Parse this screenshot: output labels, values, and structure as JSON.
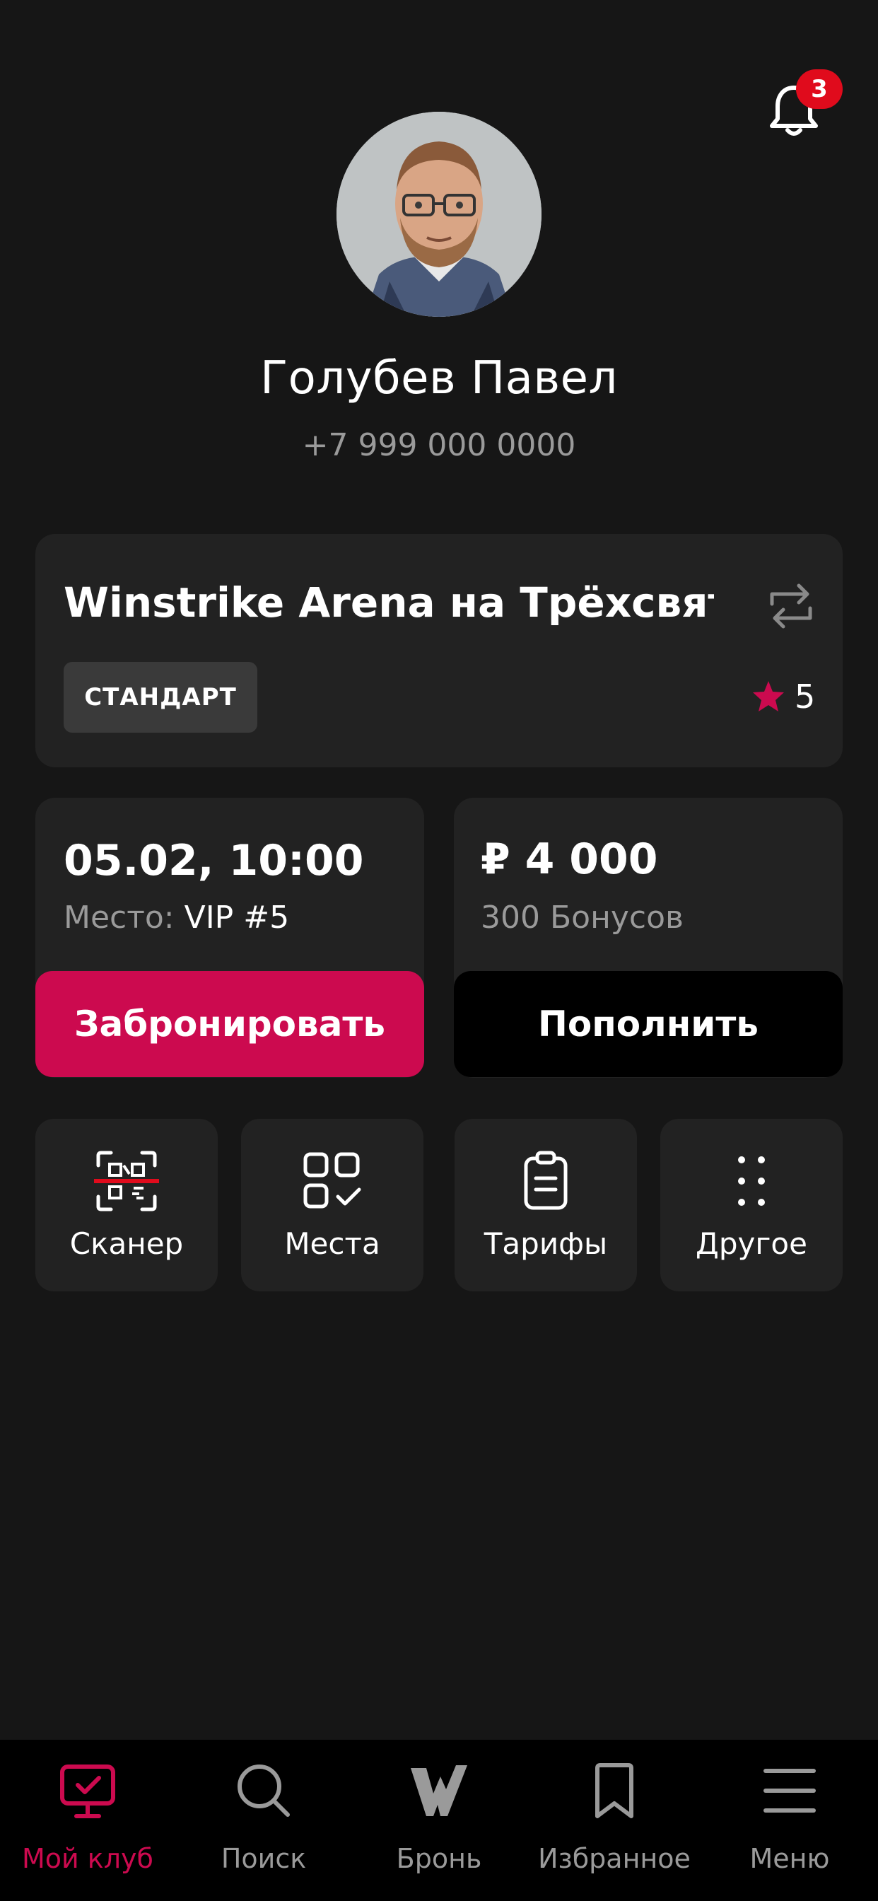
{
  "notifications": {
    "count": "3",
    "icon": "bell-icon"
  },
  "profile": {
    "name": "Голубев Павел",
    "phone": "+7 999 000 0000"
  },
  "club": {
    "title": "Winstrike Arena на Трёхсвят..",
    "tag": "СТАНДАРТ",
    "rating": "5",
    "star_color": "#cc0a4f"
  },
  "booking": {
    "datetime": "05.02, 10:00",
    "place_label": "Место:",
    "place_value": "VIP #5",
    "button": "Забронировать"
  },
  "balance": {
    "amount": "₽ 4 000",
    "bonus": "300 Бонусов",
    "button": "Пополнить"
  },
  "actions": [
    {
      "label": "Сканер",
      "icon": "qr-scanner-icon"
    },
    {
      "label": "Места",
      "icon": "seats-grid-icon"
    },
    {
      "label": "Тарифы",
      "icon": "clipboard-icon"
    },
    {
      "label": "Другое",
      "icon": "more-dots-icon"
    }
  ],
  "nav": [
    {
      "label": "Мой клуб",
      "icon": "monitor-check-icon",
      "active": true
    },
    {
      "label": "Поиск",
      "icon": "search-icon"
    },
    {
      "label": "Бронь",
      "icon": "winstrike-logo-icon"
    },
    {
      "label": "Избранное",
      "icon": "bookmark-icon"
    },
    {
      "label": "Меню",
      "icon": "menu-icon"
    }
  ],
  "colors": {
    "accent": "#cc0a4f",
    "background": "#161616",
    "card": "#222222",
    "badge": "#e00b1c"
  }
}
